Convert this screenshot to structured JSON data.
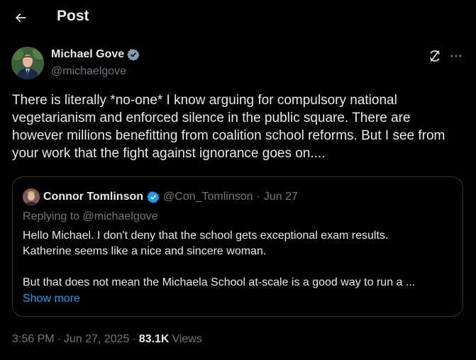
{
  "header": {
    "title": "Post"
  },
  "post": {
    "author": {
      "name": "Michael Gove",
      "handle": "@michaelgove"
    },
    "text": "There is literally *no-one* I know arguing for compulsory national vegetarianism and enforced silence in the public square. There are however millions benefitting from coalition school reforms. But I see from your work that the fight against ignorance goes on....",
    "time": "3:56 PM",
    "separator": "·",
    "date": "Jun 27, 2025",
    "views_count": "83.1K",
    "views_label": "Views"
  },
  "quote": {
    "author": {
      "name": "Connor Tomlinson",
      "handle": "@Con_Tomlinson"
    },
    "separator": "·",
    "date": "Jun 27",
    "replying_to": "Replying to @michaelgove",
    "lines": [
      "Hello Michael. I don't deny that the school gets exceptional exam results.",
      "Katherine seems like a nice and sincere woman.",
      "",
      "But that does not mean the Michaela School at-scale is a good way to run a ..."
    ],
    "show_more": "Show more"
  },
  "colors": {
    "background": "#000000",
    "text": "#e7e9ea",
    "secondary": "#71767b",
    "accent": "#1d9bf0",
    "border": "#2f3336"
  },
  "icons": [
    "back-arrow-icon",
    "verified-badge-icon",
    "grok-icon",
    "more-icon"
  ]
}
